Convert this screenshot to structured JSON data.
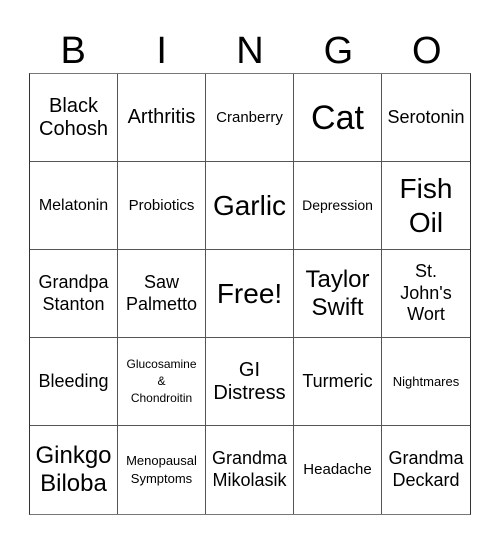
{
  "header": {
    "letters": [
      "B",
      "I",
      "N",
      "G",
      "O"
    ]
  },
  "board": {
    "rows": [
      [
        "Black\nCohosh",
        "Arthritis",
        "Cranberry",
        "Cat",
        "Serotonin"
      ],
      [
        "Melatonin",
        "Probiotics",
        "Garlic",
        "Depression",
        "Fish\nOil"
      ],
      [
        "Grandpa\nStanton",
        "Saw\nPalmetto",
        "Free!",
        "Taylor\nSwift",
        "St.\nJohn's\nWort"
      ],
      [
        "Bleeding",
        "Glucosamine\n&\nChondroitin",
        "GI\nDistress",
        "Turmeric",
        "Nightmares"
      ],
      [
        "Ginkgo\nBiloba",
        "Menopausal\nSymptoms",
        "Grandma\nMikolasik",
        "Headache",
        "Grandma\nDeckard"
      ]
    ]
  }
}
